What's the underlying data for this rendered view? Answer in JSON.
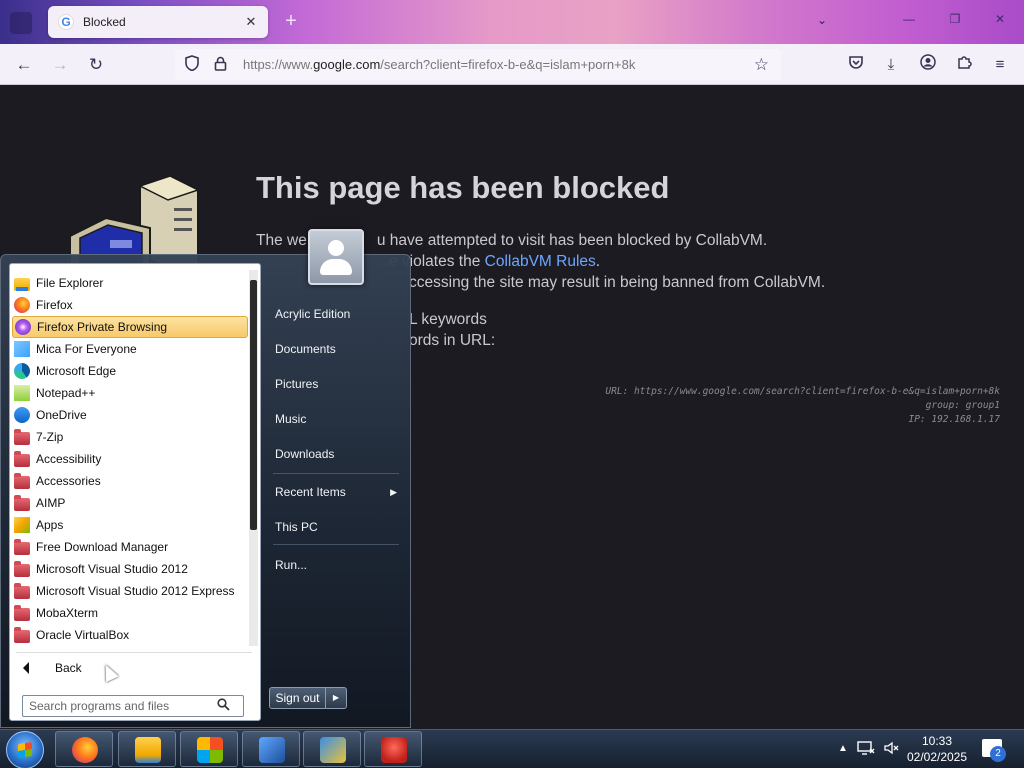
{
  "browser": {
    "tab_title": "Blocked",
    "tab_favicon": "google-g-icon",
    "url_prefix": "https://www.",
    "url_host": "google.com",
    "url_rest": "/search?client=firefox-b-e&q=islam+porn+8k"
  },
  "page": {
    "heading": "This page has been blocked",
    "line1_a": "The we",
    "line1_b": "u have attempted to visit has been blocked by CollabVM.",
    "line2_a": "e violates the ",
    "line2_link": "CollabVM Rules",
    "line2_b": ".",
    "line3": "ccessing the site may result in being banned from CollabVM.",
    "line4": "L keywords",
    "line5": "ords in URL:",
    "meta_url": "URL: https://www.google.com/search?client=firefox-b-e&q=islam+porn+8k",
    "meta_group": "group: group1",
    "meta_ip": "IP: 192.168.1.17"
  },
  "start_menu": {
    "programs": [
      {
        "label": "File Explorer",
        "icon": "file-explorer-icon"
      },
      {
        "label": "Firefox",
        "icon": "firefox-icon"
      },
      {
        "label": "Firefox Private Browsing",
        "icon": "firefox-private-icon",
        "highlighted": true
      },
      {
        "label": "Mica For Everyone",
        "icon": "mica-icon"
      },
      {
        "label": "Microsoft Edge",
        "icon": "edge-icon"
      },
      {
        "label": "Notepad++",
        "icon": "notepadpp-icon"
      },
      {
        "label": "OneDrive",
        "icon": "onedrive-icon"
      },
      {
        "label": "7-Zip",
        "icon": "folder-icon"
      },
      {
        "label": "Accessibility",
        "icon": "folder-icon"
      },
      {
        "label": "Accessories",
        "icon": "folder-icon"
      },
      {
        "label": "AIMP",
        "icon": "folder-icon"
      },
      {
        "label": "Apps",
        "icon": "apps-icon"
      },
      {
        "label": "Free Download Manager",
        "icon": "folder-icon"
      },
      {
        "label": "Microsoft Visual Studio 2012",
        "icon": "folder-icon"
      },
      {
        "label": "Microsoft Visual Studio 2012 Express",
        "icon": "folder-icon"
      },
      {
        "label": "MobaXterm",
        "icon": "folder-icon"
      },
      {
        "label": "Oracle VirtualBox",
        "icon": "folder-icon"
      }
    ],
    "back_label": "Back",
    "search_placeholder": "Search programs and files",
    "places": [
      {
        "label": "Acrylic Edition"
      },
      {
        "label": "Documents"
      },
      {
        "label": "Pictures"
      },
      {
        "label": "Music"
      },
      {
        "label": "Downloads"
      },
      {
        "label": "Recent Items",
        "has_submenu": true
      },
      {
        "label": "This PC"
      },
      {
        "label": "Run..."
      }
    ],
    "shutdown_label": "Sign out"
  },
  "taskbar": {
    "apps": [
      "firefox-icon",
      "file-explorer-icon",
      "microsoft-store-icon",
      "app-icon",
      "visual-studio-icon",
      "app-icon"
    ],
    "time": "10:33",
    "date": "02/02/2025",
    "notification_count": "2"
  }
}
